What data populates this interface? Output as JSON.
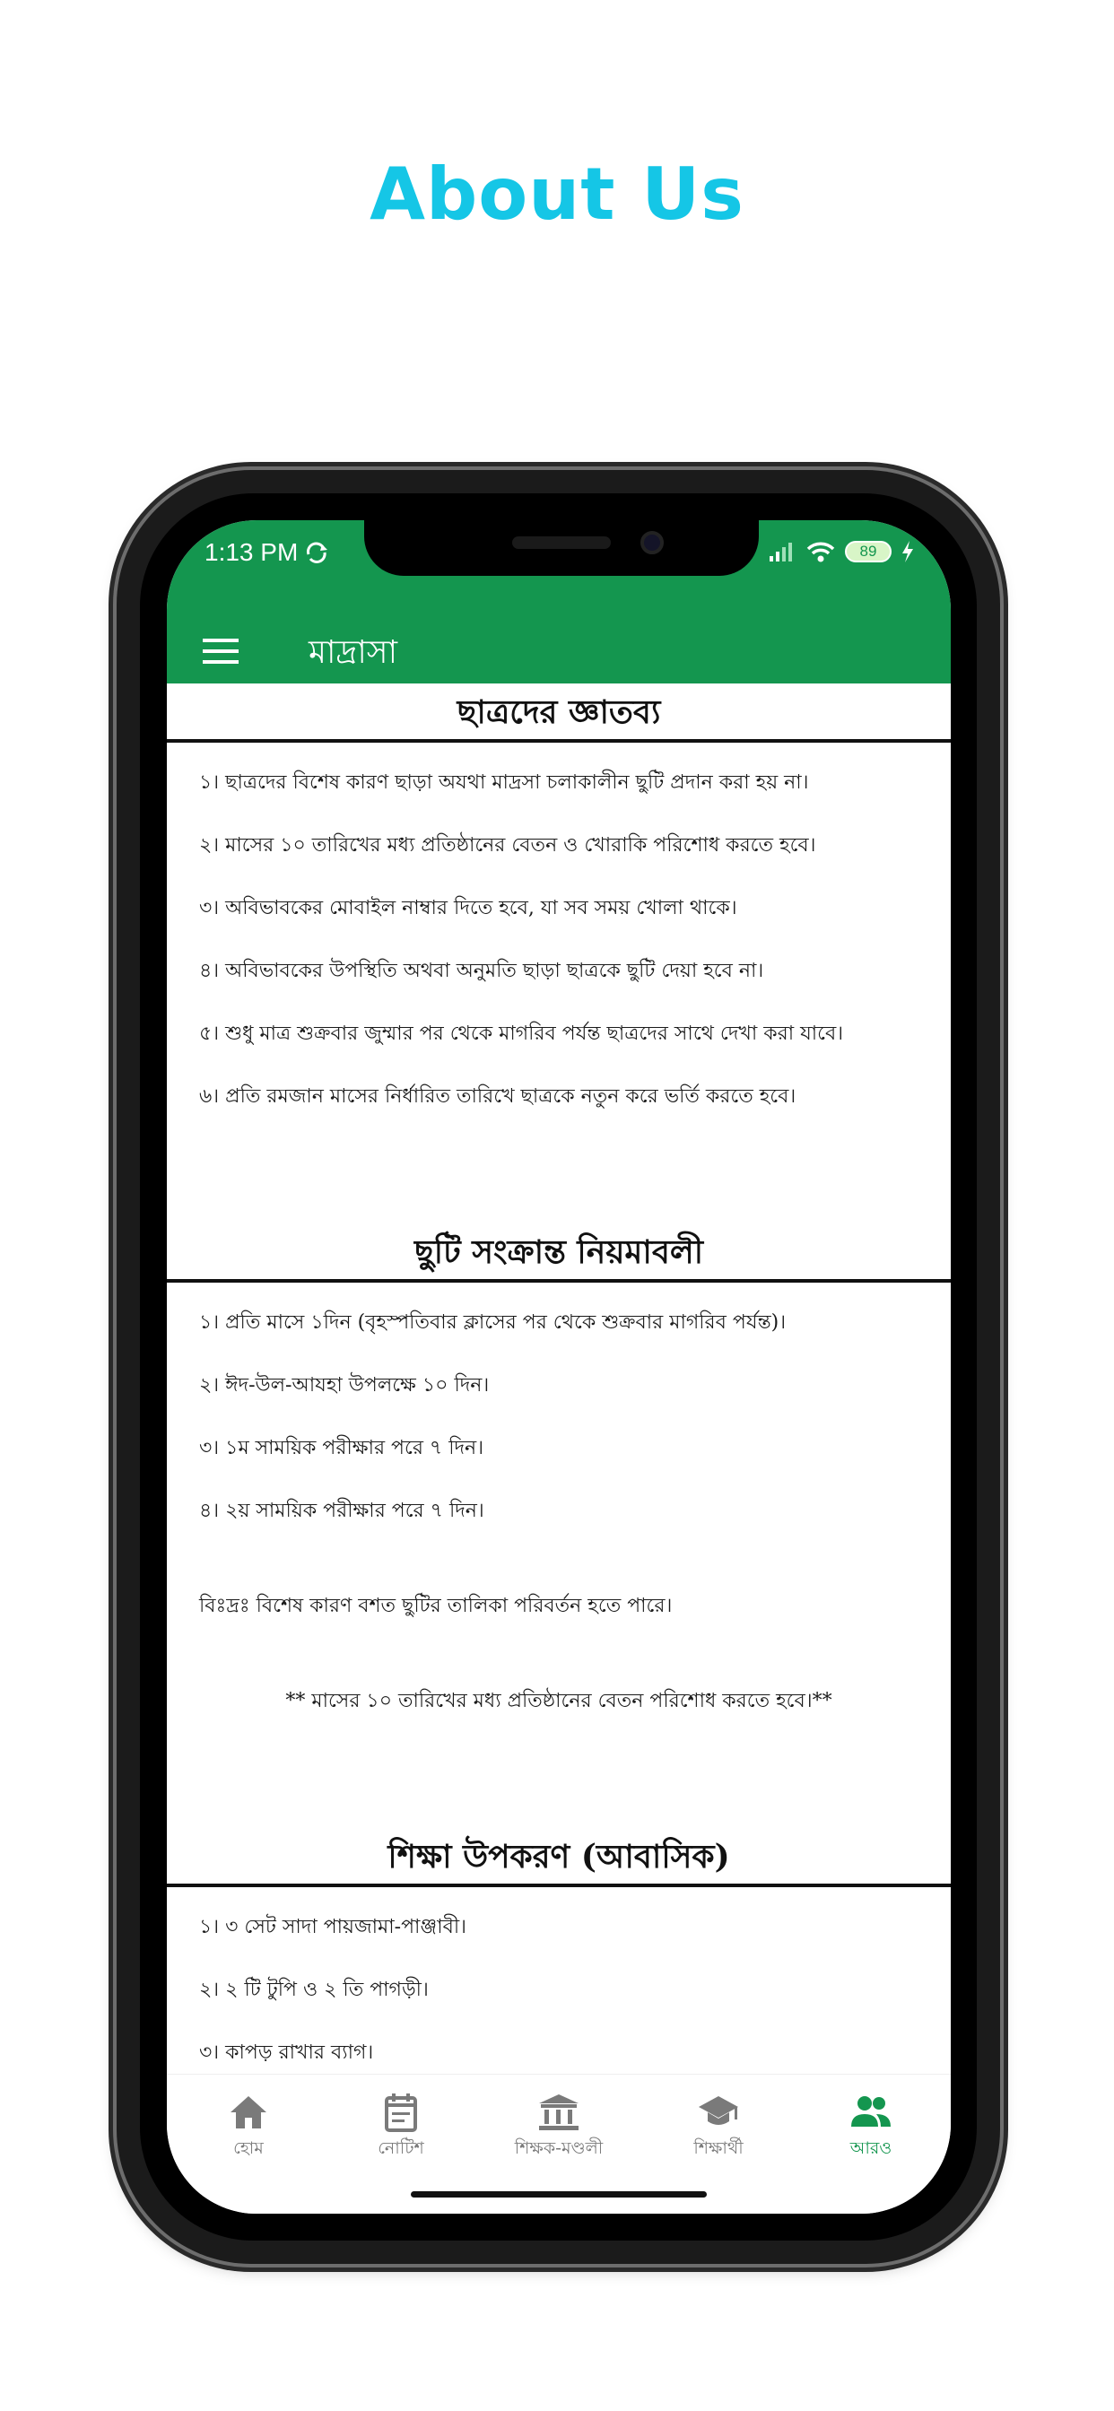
{
  "heading": "About Us",
  "status_bar": {
    "time": "1:13 PM",
    "battery": "89",
    "icons": [
      "sync-icon",
      "signal-icon",
      "wifi-icon",
      "battery-icon",
      "charging-icon"
    ]
  },
  "app_bar": {
    "title": "মাদ্রাসা",
    "menu_icon": "hamburger-menu-icon"
  },
  "sections": [
    {
      "title": "ছাত্রদের জ্ঞাতব্য",
      "items": [
        "১। ছাত্রদের বিশেষ কারণ ছাড়া অযথা মাদ্রসা চলাকালীন ছুটি প্রদান করা হয় না।",
        "২। মাসের ১০ তারিখের মধ্য প্রতিষ্ঠানের বেতন ও খোরাকি পরিশোধ করতে হবে।",
        "৩। অবিভাবকের মোবাইল নাম্বার দিতে হবে, যা সব সময় খোলা থাকে।",
        "৪। অবিভাবকের উপস্থিতি অথবা অনুমতি ছাড়া ছাত্রকে ছুটি দেয়া হবে না।",
        "৫। শুধু মাত্র শুক্রবার জুম্মার পর থেকে মাগরিব পর্যন্ত ছাত্রদের সাথে দেখা করা যাবে।",
        "৬। প্রতি রমজান মাসের নির্ধারিত তারিখে ছাত্রকে নতুন করে ভর্তি করতে হবে।"
      ]
    },
    {
      "title": "ছুটি সংক্রান্ত নিয়মাবলী",
      "items": [
        "১। প্রতি মাসে ১দিন (বৃহস্পতিবার ক্লাসের পর থেকে শুক্রবার মাগরিব পর্যন্ত)।",
        "২। ঈদ-উল-আযহা উপলক্ষে ১০ দিন।",
        "৩। ১ম সাময়িক পরীক্ষার পরে ৭ দিন।",
        "৪। ২য় সাময়িক পরীক্ষার পরে ৭ দিন।"
      ],
      "note": "বিঃদ্রঃ বিশেষ কারণ বশত ছুটির তালিকা পরিবর্তন হতে পারে।",
      "center_note": "** মাসের ১০ তারিখের মধ্য প্রতিষ্ঠানের বেতন পরিশোধ করতে হবে।**"
    },
    {
      "title": "শিক্ষা উপকরণ (আবাসিক)",
      "items": [
        "১। ৩ সেট সাদা পায়জামা-পাঞ্জাবী।",
        "২। ২ টি টুপি ও ২ তি পাগড়ী।",
        "৩। কাপড় রাখার ব্যাগ।"
      ]
    }
  ],
  "bottom_nav": [
    {
      "label": "হোম",
      "icon": "home-icon",
      "active": false
    },
    {
      "label": "নোটিশ",
      "icon": "notice-icon",
      "active": false
    },
    {
      "label": "শিক্ষক-মণ্ডলী",
      "icon": "institution-icon",
      "active": false
    },
    {
      "label": "শিক্ষার্থী",
      "icon": "graduation-cap-icon",
      "active": false
    },
    {
      "label": "আরও",
      "icon": "people-icon",
      "active": true
    }
  ],
  "colors": {
    "heading": "#15c6e6",
    "primary": "#14964f",
    "inactive_nav": "#7a7a7a"
  }
}
